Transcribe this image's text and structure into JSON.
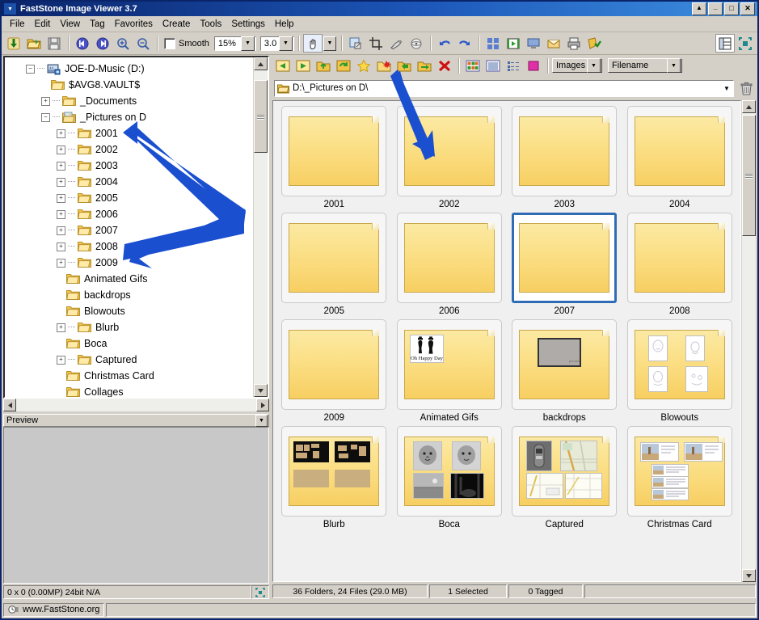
{
  "window": {
    "title": "FastStone Image Viewer 3.7",
    "sysmenu_icon": "chevron-down-icon",
    "buttons": {
      "rollup": "↕",
      "minimize": "_",
      "maximize": "□",
      "close": "✕"
    }
  },
  "menu": {
    "items": [
      "File",
      "Edit",
      "View",
      "Tag",
      "Favorites",
      "Create",
      "Tools",
      "Settings",
      "Help"
    ]
  },
  "toolbar_main": {
    "buttons": [
      {
        "name": "download-icon"
      },
      {
        "name": "open-folder-icon"
      },
      {
        "name": "save-icon"
      },
      {
        "name": "previous-image-icon"
      },
      {
        "name": "next-image-icon"
      },
      {
        "name": "zoom-in-icon"
      },
      {
        "name": "zoom-out-icon"
      }
    ],
    "smooth_label": "Smooth",
    "smooth_checked": false,
    "zoom_value": "15%",
    "ratio_value": "3.0",
    "hand_tool_icon": "hand-icon",
    "right_buttons": [
      {
        "name": "resize-icon"
      },
      {
        "name": "crop-icon"
      },
      {
        "name": "draw-icon"
      },
      {
        "name": "effects-icon"
      },
      {
        "name": "undo-icon"
      },
      {
        "name": "redo-icon"
      },
      {
        "name": "compare-icon"
      },
      {
        "name": "slideshow-icon"
      },
      {
        "name": "wallpaper-icon"
      },
      {
        "name": "email-icon"
      },
      {
        "name": "print-icon"
      },
      {
        "name": "favorites-icon"
      }
    ],
    "far_right_buttons": [
      {
        "name": "layout-panel-icon"
      },
      {
        "name": "fullscreen-icon"
      }
    ]
  },
  "toolbar_browser": {
    "buttons": [
      {
        "name": "back-icon"
      },
      {
        "name": "forward-icon"
      },
      {
        "name": "up-folder-icon"
      },
      {
        "name": "refresh-icon"
      },
      {
        "name": "favorite-star-icon"
      },
      {
        "name": "new-folder-icon"
      },
      {
        "name": "copy-to-folder-icon"
      },
      {
        "name": "move-to-folder-icon"
      },
      {
        "name": "delete-icon"
      },
      {
        "name": "thumbnail-view-icon"
      },
      {
        "name": "list-view-icon"
      },
      {
        "name": "detail-view-icon"
      },
      {
        "name": "color-tag-icon"
      }
    ],
    "filter_value": "Images",
    "sort_value": "Filename"
  },
  "address": {
    "folder_icon": "folder-icon",
    "path": "D:\\_Pictures on D\\",
    "dropdown_icon": "chevron-down-icon",
    "trash_icon": "recycle-bin-icon"
  },
  "tree": {
    "items": [
      {
        "label": "JOE-D-Music (D:)",
        "depth": 0,
        "expander": "minus",
        "icon": "drive-icon"
      },
      {
        "label": "$AVG8.VAULT$",
        "depth": 1,
        "expander": "none",
        "icon": "folder-icon"
      },
      {
        "label": "_Documents",
        "depth": 1,
        "expander": "plus",
        "icon": "folder-icon"
      },
      {
        "label": "_Pictures on D",
        "depth": 1,
        "expander": "minus",
        "icon": "pictures-folder-icon"
      },
      {
        "label": "2001",
        "depth": 2,
        "expander": "plus",
        "icon": "folder-icon"
      },
      {
        "label": "2002",
        "depth": 2,
        "expander": "plus",
        "icon": "folder-icon"
      },
      {
        "label": "2003",
        "depth": 2,
        "expander": "plus",
        "icon": "folder-icon"
      },
      {
        "label": "2004",
        "depth": 2,
        "expander": "plus",
        "icon": "folder-icon"
      },
      {
        "label": "2005",
        "depth": 2,
        "expander": "plus",
        "icon": "folder-icon"
      },
      {
        "label": "2006",
        "depth": 2,
        "expander": "plus",
        "icon": "folder-icon"
      },
      {
        "label": "2007",
        "depth": 2,
        "expander": "plus",
        "icon": "folder-icon"
      },
      {
        "label": "2008",
        "depth": 2,
        "expander": "plus",
        "icon": "folder-icon"
      },
      {
        "label": "2009",
        "depth": 2,
        "expander": "plus",
        "icon": "folder-icon"
      },
      {
        "label": "Animated Gifs",
        "depth": 2,
        "expander": "none",
        "icon": "folder-icon"
      },
      {
        "label": "backdrops",
        "depth": 2,
        "expander": "none",
        "icon": "folder-icon"
      },
      {
        "label": "Blowouts",
        "depth": 2,
        "expander": "none",
        "icon": "folder-icon"
      },
      {
        "label": "Blurb",
        "depth": 2,
        "expander": "plus",
        "icon": "folder-icon"
      },
      {
        "label": "Boca",
        "depth": 2,
        "expander": "none",
        "icon": "folder-icon"
      },
      {
        "label": "Captured",
        "depth": 2,
        "expander": "plus",
        "icon": "folder-icon"
      },
      {
        "label": "Christmas Card",
        "depth": 2,
        "expander": "none",
        "icon": "folder-icon"
      },
      {
        "label": "Collages",
        "depth": 2,
        "expander": "none",
        "icon": "folder-icon"
      }
    ]
  },
  "preview": {
    "title": "Preview",
    "dropdown_icon": "chevron-down-icon"
  },
  "status_left": {
    "info": "0 x 0 (0.00MP)  24bit N/A",
    "fit_icon": "fit-screen-icon"
  },
  "status_right": {
    "counts": "36 Folders, 24 Files (29.0 MB)",
    "selected": "1 Selected",
    "tagged": "0 Tagged"
  },
  "bottom": {
    "icons": [
      "clock-icon",
      "lines-icon"
    ],
    "site": "www.FastStone.org"
  },
  "thumbnails": {
    "selected_index": 6,
    "items": [
      {
        "label": "2001",
        "content": "empty"
      },
      {
        "label": "2002",
        "content": "empty"
      },
      {
        "label": "2003",
        "content": "empty"
      },
      {
        "label": "2004",
        "content": "empty"
      },
      {
        "label": "2005",
        "content": "empty"
      },
      {
        "label": "2006",
        "content": "empty"
      },
      {
        "label": "2007",
        "content": "empty"
      },
      {
        "label": "2008",
        "content": "empty"
      },
      {
        "label": "2009",
        "content": "empty"
      },
      {
        "label": "Animated Gifs",
        "content": "oh-happy-day"
      },
      {
        "label": "backdrops",
        "content": "gray-backdrop"
      },
      {
        "label": "Blowouts",
        "content": "sketch-sheets"
      },
      {
        "label": "Blurb",
        "content": "book-layouts"
      },
      {
        "label": "Boca",
        "content": "photos-bw"
      },
      {
        "label": "Captured",
        "content": "maps-screens"
      },
      {
        "label": "Christmas Card",
        "content": "postcards"
      }
    ]
  },
  "colors": {
    "title_blue": "#0a246a",
    "selection_blue": "#2f6cb5",
    "folder_yellow": "#fbdf85",
    "arrow_blue": "#1a4fd0",
    "window_face": "#d4d0c8"
  },
  "annotations": {
    "arrows": [
      {
        "name": "arrow-pointing-to-year-folders"
      },
      {
        "name": "arrow-pointing-to-new-folder-button"
      }
    ]
  }
}
